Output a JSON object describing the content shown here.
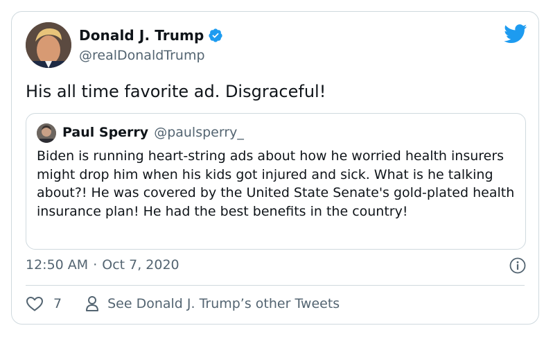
{
  "author": {
    "name": "Donald J. Trump",
    "handle": "@realDonaldTrump",
    "avatar_icon": "profile-photo",
    "verified": true
  },
  "tweet": {
    "text": "His all time favorite ad. Disgraceful!"
  },
  "quoted_tweet": {
    "name": "Paul Sperry",
    "handle": "@paulsperry_",
    "text": "Biden is running heart-string ads about how he worried health insurers might drop him when his kids got injured and sick. What is he talking about?! He was covered by the United State Senate's gold-plated health insurance plan! He had the best benefits in the country!"
  },
  "meta": {
    "time": "12:50 AM",
    "separator": "·",
    "date": "Oct 7, 2020"
  },
  "actions": {
    "like_count": "7",
    "other_tweets_label": "See Donald J. Trump’s other Tweets"
  },
  "icons": {
    "brand": "twitter-bird-icon",
    "verified": "verified-badge-icon",
    "info": "info-icon",
    "like": "heart-icon",
    "profile": "person-icon"
  },
  "colors": {
    "brand_blue": "#1d9bf0",
    "text_primary": "#0f1419",
    "text_secondary": "#536471",
    "border": "#cfd9de"
  }
}
